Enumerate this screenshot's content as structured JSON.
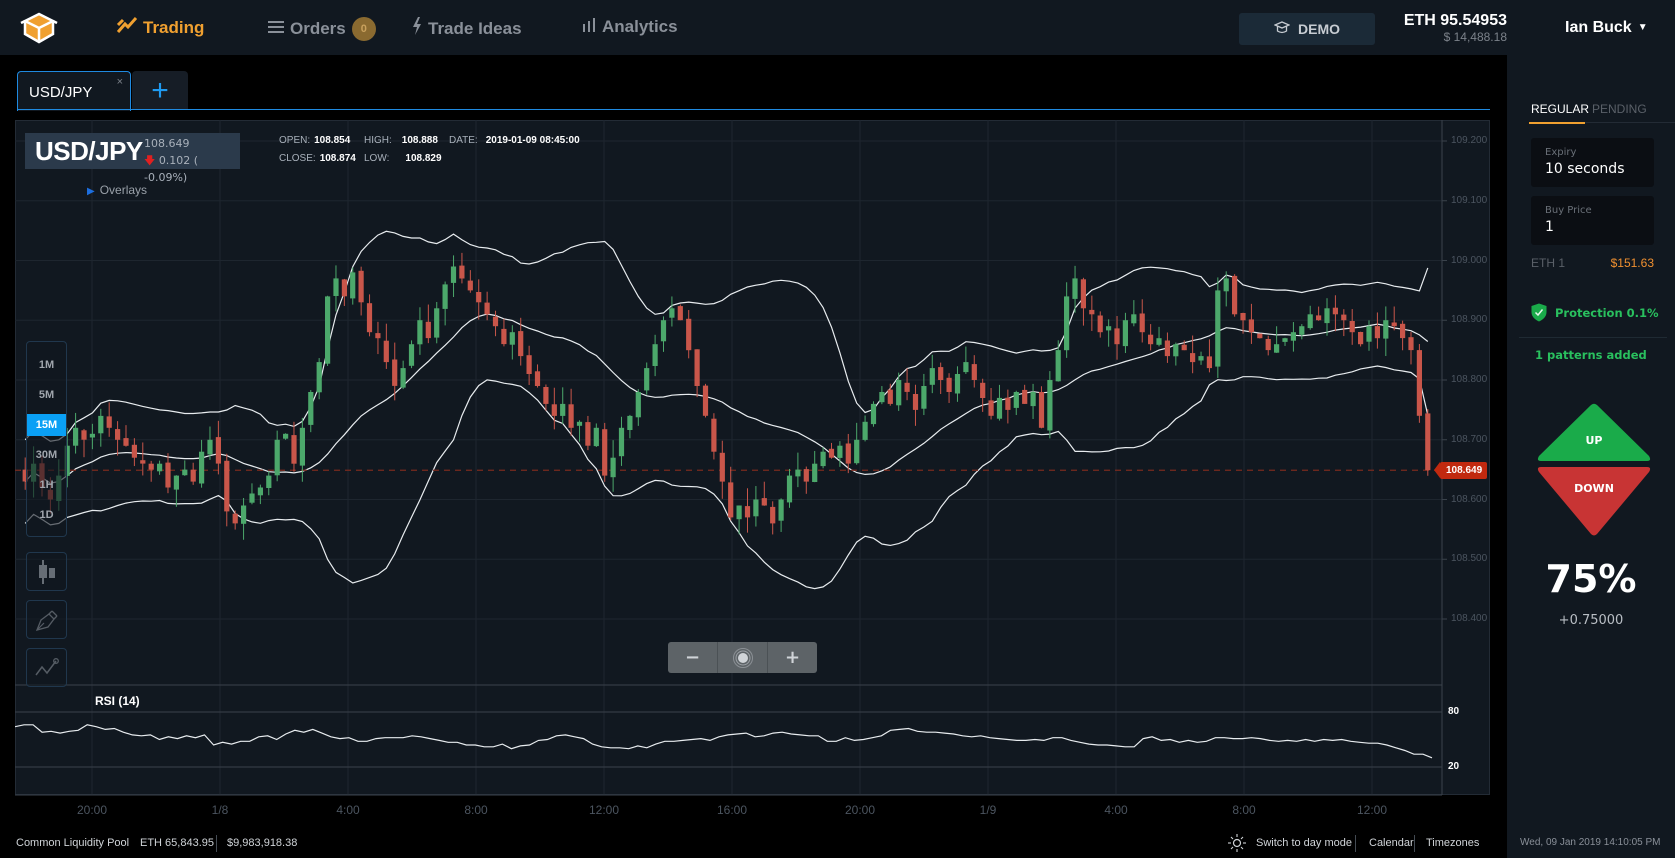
{
  "nav": {
    "items": [
      {
        "label": "Trading",
        "icon": "trading-icon",
        "active": true
      },
      {
        "label": "Orders",
        "icon": "list-icon",
        "badge": "0"
      },
      {
        "label": "Trade Ideas",
        "icon": "lightning-icon"
      },
      {
        "label": "Analytics",
        "icon": "bars-icon"
      }
    ],
    "demo_label": "DEMO",
    "balance_eth": "ETH 95.54953",
    "balance_usd": "$ 14,488.18",
    "user_name": "Ian Buck"
  },
  "tabs": {
    "active_label": "USD/JPY",
    "close_glyph": "×",
    "add_glyph": "+"
  },
  "chart_header": {
    "symbol": "USD/JPY",
    "price": "108.649",
    "change": "0.102 ( -0.09%)",
    "open_label": "OPEN:",
    "open": "108.854",
    "high_label": "HIGH:",
    "high": "108.888",
    "close_label": "CLOSE:",
    "close": "108.874",
    "low_label": "LOW:",
    "low": "108.829",
    "date_label": "DATE:",
    "date": "2019-01-09 08:45:00",
    "overlays_label": "Overlays"
  },
  "timeframes": {
    "options": [
      "1M",
      "5M",
      "15M",
      "30M",
      "1H",
      "1D"
    ],
    "selected": "15M"
  },
  "zoom_controls": {
    "minus": "−",
    "plus": "+"
  },
  "rsi_label": "RSI (14)",
  "last_price_tag": "108.649",
  "chart_data": {
    "type": "candlestick",
    "symbol": "USD/JPY",
    "interval": "15M",
    "price_axis": {
      "ticks": [
        "109.200",
        "109.100",
        "109.000",
        "108.900",
        "108.800",
        "108.700",
        "108.600",
        "108.500",
        "108.400"
      ],
      "range": [
        108.33,
        109.23
      ]
    },
    "x_ticks": [
      "20:00",
      "1/8",
      "4:00",
      "8:00",
      "12:00",
      "16:00",
      "20:00",
      "1/9",
      "4:00",
      "8:00",
      "12:00"
    ],
    "last_price": 108.649,
    "candle_closes": [
      108.63,
      108.66,
      108.62,
      108.6,
      108.64,
      108.69,
      108.72,
      108.7,
      108.71,
      108.74,
      108.72,
      108.7,
      108.69,
      108.67,
      108.66,
      108.65,
      108.66,
      108.62,
      108.64,
      108.65,
      108.63,
      108.68,
      108.7,
      108.66,
      108.58,
      108.56,
      108.59,
      108.61,
      108.62,
      108.64,
      108.7,
      108.71,
      108.66,
      108.72,
      108.78,
      108.83,
      108.94,
      108.97,
      108.94,
      108.98,
      108.93,
      108.88,
      108.87,
      108.83,
      108.79,
      108.82,
      108.86,
      108.9,
      108.87,
      108.92,
      108.96,
      108.99,
      108.97,
      108.95,
      108.93,
      108.91,
      108.89,
      108.86,
      108.88,
      108.84,
      108.81,
      108.79,
      108.76,
      108.74,
      108.76,
      108.72,
      108.73,
      108.69,
      108.72,
      108.64,
      108.67,
      108.72,
      108.74,
      108.78,
      108.82,
      108.86,
      108.9,
      108.92,
      108.9,
      108.85,
      108.79,
      108.74,
      108.68,
      108.63,
      108.57,
      108.59,
      108.57,
      108.6,
      108.59,
      108.56,
      108.6,
      108.64,
      108.65,
      108.63,
      108.66,
      108.68,
      108.67,
      108.69,
      108.66,
      108.7,
      108.73,
      108.76,
      108.78,
      108.76,
      108.8,
      108.78,
      108.75,
      108.79,
      108.82,
      108.8,
      108.78,
      108.81,
      108.83,
      108.8,
      108.77,
      108.74,
      108.77,
      108.75,
      108.78,
      108.76,
      108.78,
      108.72,
      108.8,
      108.85,
      108.94,
      108.97,
      108.92,
      108.91,
      108.88,
      108.89,
      108.86,
      108.9,
      108.91,
      108.88,
      108.86,
      108.87,
      108.84,
      108.86,
      108.85,
      108.83,
      108.84,
      108.82,
      108.95,
      108.97,
      108.91,
      108.9,
      108.88,
      108.87,
      108.85,
      108.86,
      108.87,
      108.88,
      108.89,
      108.91,
      108.9,
      108.92,
      108.91,
      108.9,
      108.88,
      108.86,
      108.89,
      108.87,
      108.9,
      108.89,
      108.87,
      108.85,
      108.74,
      108.649
    ],
    "bollinger": {
      "period": 20,
      "stdev": 2
    },
    "rsi": {
      "period": 14,
      "levels": [
        80,
        20
      ],
      "values": [
        64,
        66,
        66,
        58,
        59,
        57,
        59,
        60,
        66,
        64,
        61,
        62,
        58,
        55,
        54,
        55,
        50,
        53,
        51,
        54,
        52,
        55,
        44,
        47,
        45,
        48,
        48,
        53,
        54,
        50,
        56,
        60,
        58,
        61,
        57,
        53,
        51,
        52,
        48,
        48,
        51,
        52,
        52,
        52,
        54,
        53,
        51,
        49,
        47,
        47,
        44,
        44,
        42,
        42,
        45,
        40,
        43,
        44,
        49,
        50,
        54,
        55,
        53,
        51,
        45,
        42,
        41,
        41,
        40,
        43,
        41,
        45,
        48,
        48,
        49,
        50,
        51,
        49,
        53,
        55,
        56,
        57,
        53,
        54,
        57,
        58,
        56,
        55,
        54,
        54,
        48,
        48,
        52,
        49,
        50,
        52,
        54,
        60,
        61,
        62,
        59,
        58,
        58,
        57,
        56,
        54,
        53,
        54,
        52,
        51,
        50,
        49,
        49,
        50,
        49,
        52,
        52,
        49,
        47,
        45,
        44,
        44,
        43,
        42,
        42,
        51,
        53,
        49,
        50,
        47,
        49,
        47,
        48,
        52,
        52,
        51,
        51,
        52,
        51,
        49,
        48,
        49,
        48,
        50,
        48,
        50,
        49,
        50,
        48,
        47,
        46,
        46,
        44,
        41,
        38,
        34,
        34,
        30
      ]
    }
  },
  "footer": {
    "pool_label": "Common Liquidity Pool",
    "pool_eth": "ETH 65,843.95",
    "pool_usd": "$9,983,918.38",
    "day_mode": "Switch to day mode",
    "calendar": "Calendar",
    "timezones": "Timezones",
    "datetime": "Wed, 09 Jan 2019 14:10:05 PM"
  },
  "right_panel": {
    "tab_regular": "REGULAR",
    "tab_pending": "PENDING",
    "expiry_label": "Expiry",
    "expiry_value": "10 seconds",
    "buy_label": "Buy Price",
    "buy_value": "1",
    "eth_amount": "ETH 1",
    "usd_amount": "$151.63",
    "protection": "Protection 0.1%",
    "patterns": "1 patterns added",
    "up_label": "UP",
    "down_label": "DOWN",
    "payout_percent": "75%",
    "payout_value": "+0.75000",
    "up_color": "#1aab4a",
    "down_color": "#c83434"
  }
}
